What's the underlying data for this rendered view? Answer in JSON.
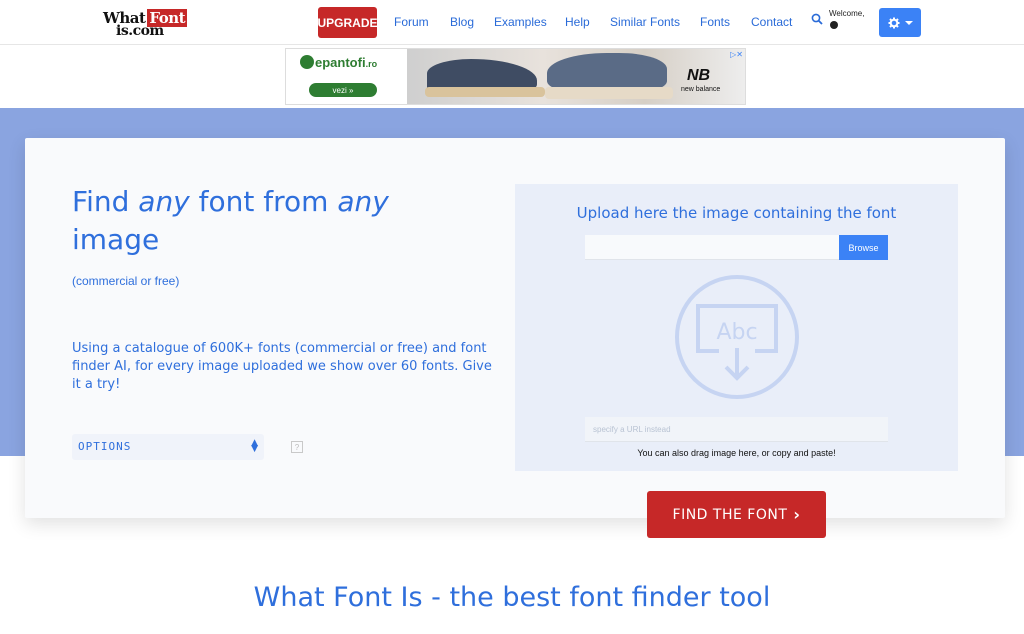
{
  "nav": {
    "logo_line1": "What",
    "logo_font": "Font",
    "logo_line2": "is.com",
    "upgrade": "UPGRADE",
    "links": [
      "Forum",
      "Blog",
      "Examples",
      "Help",
      "Similar Fonts",
      "Fonts",
      "Contact"
    ],
    "welcome": "Welcome,",
    "search_icon": "search-icon",
    "settings_icon": "gear-icon"
  },
  "ad": {
    "brand": "epantofi",
    "brand_suffix": ".ro",
    "cta": "vezi »",
    "advertiser": "NB",
    "advertiser_text": "new balance",
    "close": "▷✕"
  },
  "hero": {
    "title_a": "Find ",
    "title_any1": "any",
    "title_b": " font from ",
    "title_any2": "any",
    "title_c": " image",
    "subtitle": "(commercial or free)",
    "description": "Using a catalogue of 600K+ fonts (commercial or free) and font finder AI, for every image uploaded we show over 60 fonts. Give it a try!",
    "options_label": "OPTIONS",
    "help": "?"
  },
  "upload": {
    "title": "Upload here the image containing the font",
    "browse": "Browse",
    "url_placeholder": "specify a URL instead",
    "icon_text": "Abc",
    "drag_hint": "You can also drag image here, or copy and paste!"
  },
  "cta": {
    "find": "FIND THE FONT",
    "chevron": "›"
  },
  "footer": {
    "title": "What Font Is - the best font finder tool"
  },
  "colors": {
    "accent": "#2f6fdc",
    "brand_red": "#c62828",
    "hero_bg": "#8aa4e0",
    "button_blue": "#3b82f6"
  }
}
